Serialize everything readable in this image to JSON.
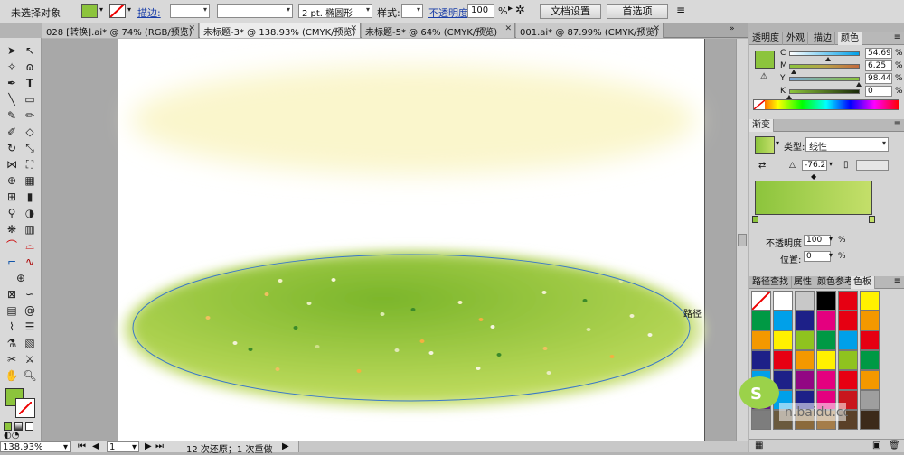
{
  "control_bar": {
    "selection_status": "未选择对象",
    "fill_color": "#8cc43c",
    "stroke_label": "描边:",
    "stroke_width_value": "",
    "brush_value": "",
    "profile_value": "2 pt. 椭圆形",
    "style_label": "样式:",
    "opacity_label": "不透明度",
    "opacity_value": "100",
    "opacity_unit": "%",
    "doc_setup_label": "文档设置",
    "preferences_label": "首选项"
  },
  "tabs": [
    {
      "label": "028 [转换].ai* @ 74% (RGB/预览)"
    },
    {
      "label": "未标题-3* @ 138.93% (CMYK/预览)"
    },
    {
      "label": "未标题-5* @ 64% (CMYK/预览)"
    },
    {
      "label": "001.ai* @ 87.99% (CMYK/预览)"
    }
  ],
  "canvas": {
    "path_label": "路径",
    "top_ellipse_color": "#faf6cc",
    "green_light": "#c5df62",
    "green_dark": "#7ab52a",
    "path_stroke_color": "#3a78c8"
  },
  "status": {
    "zoom": "138.93%",
    "page": "1",
    "history": "12 次还原；1 次重做"
  },
  "color_panel": {
    "tabs": [
      "透明度",
      "外观",
      "描边",
      "颜色"
    ],
    "c_label": "C",
    "c_value": "54.69",
    "m_label": "M",
    "m_value": "6.25",
    "y_label": "Y",
    "y_value": "98.44",
    "k_label": "K",
    "k_value": "0",
    "c_level": 0.5469,
    "m_level": 0.0625,
    "y_level": 0.9844,
    "k_level": 0.0,
    "current_color": "#8cc43c"
  },
  "gradient_panel": {
    "title": "渐变",
    "type_label": "类型:",
    "type_value": "线性",
    "angle_value": "-76.2",
    "opacity_label": "不透明度",
    "opacity_value": "100",
    "opacity_unit": "%",
    "location_label": "位置:",
    "location_value": "0",
    "location_unit": "%",
    "gradient_start": "#8cc43c",
    "gradient_end": "#c4df6a"
  },
  "swatches_panel": {
    "tabs": [
      "路径查找",
      "属性",
      "颜色参考",
      "色板"
    ],
    "colors": [
      "#ffffff",
      "#c8c8c8",
      "#000000",
      "#e60012",
      "#fff100",
      "#009944",
      "#00a0e9",
      "#1d2088",
      "#e4007f",
      "#e60012",
      "#f39800",
      "#f39800",
      "#fff100",
      "#8fc31f",
      "#009944",
      "#00a0e9",
      "#e60012",
      "#1d2088",
      "#e60012",
      "#f39800",
      "#fff100",
      "#8fc31f",
      "#009944",
      "#00a0e9",
      "#1d2088",
      "#920783",
      "#e4007f",
      "#e60012",
      "#f39800",
      "#601986",
      "#00a0e9",
      "#1d2088",
      "#e4007f",
      "#c8161d",
      "#9e9e9e",
      "#7d7d7d",
      "#6a5a3e",
      "#8b6a3c",
      "#a57d4a",
      "#5a4028",
      "#3c2a1a",
      "#2b2b2b"
    ]
  }
}
